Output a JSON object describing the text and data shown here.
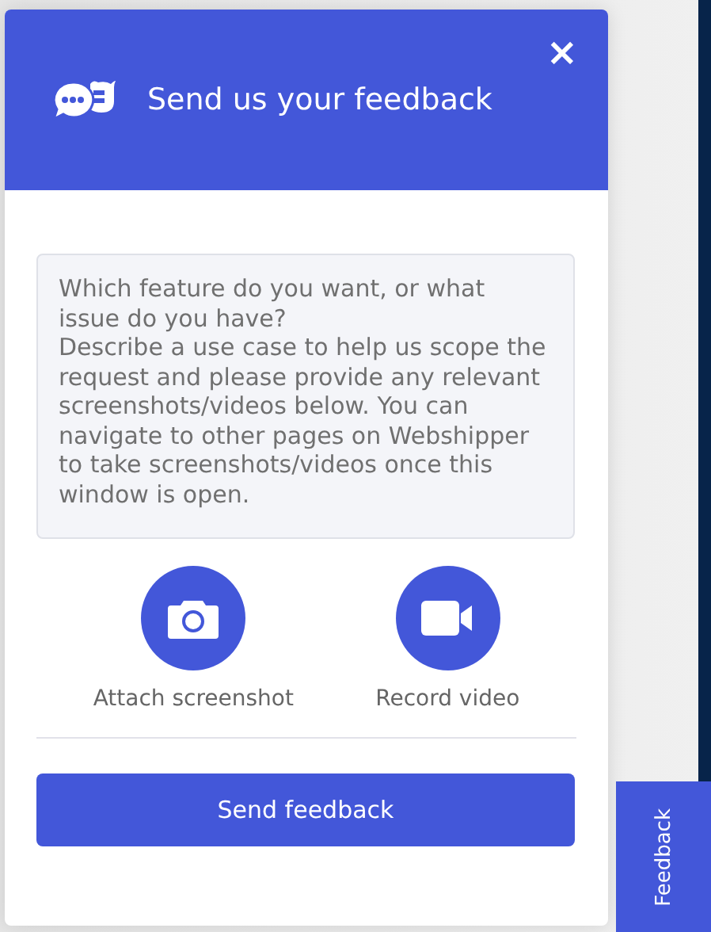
{
  "dialog": {
    "title": "Send us your feedback",
    "close": "×",
    "message": {
      "placeholder": "Which feature do you want, or what issue do you have?\nDescribe a use case to help us scope the request and please provide any relevant screenshots/videos below. You can navigate to other pages on Webshipper to take screenshots/videos once this window is open."
    },
    "attachments": [
      {
        "kind": "screenshot",
        "label": "Attach screenshot"
      },
      {
        "kind": "video",
        "label": "Record video"
      }
    ],
    "submit": "Send feedback"
  },
  "side_tab": {
    "label": "Feedback"
  }
}
